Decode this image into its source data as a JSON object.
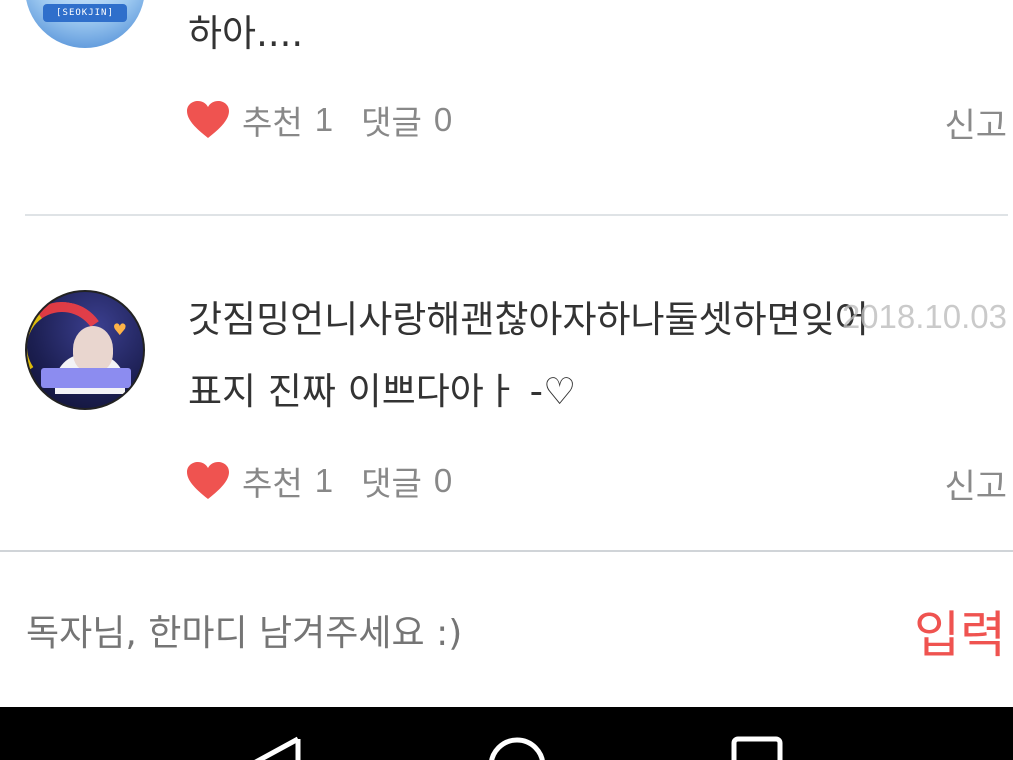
{
  "comments": [
    {
      "text_lines": [
        "하아...."
      ],
      "actions": {
        "like_label": "추천",
        "like_count": "1",
        "reply_label": "댓글",
        "reply_count": "0",
        "report_label": "신고"
      },
      "avatar_badge": "[SEOKJIN]"
    },
    {
      "text_lines": [
        "갓짐밍언니사랑해괜찮아자하나둘셋하면잊어",
        "표지 진짜 이쁘다아ㅏ -♡"
      ],
      "date": "2018.10.03",
      "actions": {
        "like_label": "추천",
        "like_count": "1",
        "reply_label": "댓글",
        "reply_count": "0",
        "report_label": "신고"
      }
    }
  ],
  "input": {
    "placeholder": "독자님, 한마디 남겨주세요 :)",
    "submit_label": "입력"
  },
  "colors": {
    "heart": "#ef5350",
    "submit": "#ef5350",
    "text": "#333333",
    "muted": "#888888"
  },
  "nav_icons": [
    "back-icon",
    "home-icon",
    "recents-icon"
  ]
}
